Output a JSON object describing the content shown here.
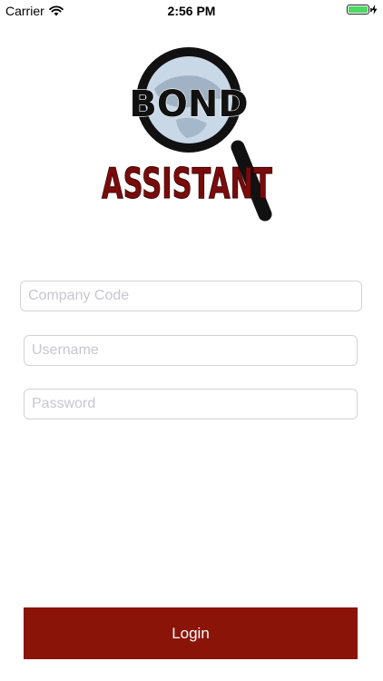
{
  "status_bar": {
    "carrier": "Carrier",
    "time": "2:56 PM",
    "battery_level": 1.0,
    "battery_color": "#4cd964"
  },
  "logo": {
    "word_top": "BOND",
    "word_bottom": "ASSISTANT",
    "icon": "magnifying-glass-globe",
    "text_color": "#7a0b0b"
  },
  "form": {
    "company_code": {
      "placeholder": "Company Code",
      "value": ""
    },
    "username": {
      "placeholder": "Username",
      "value": ""
    },
    "password": {
      "placeholder": "Password",
      "value": ""
    }
  },
  "login_button": {
    "label": "Login",
    "color": "#8a1408"
  }
}
